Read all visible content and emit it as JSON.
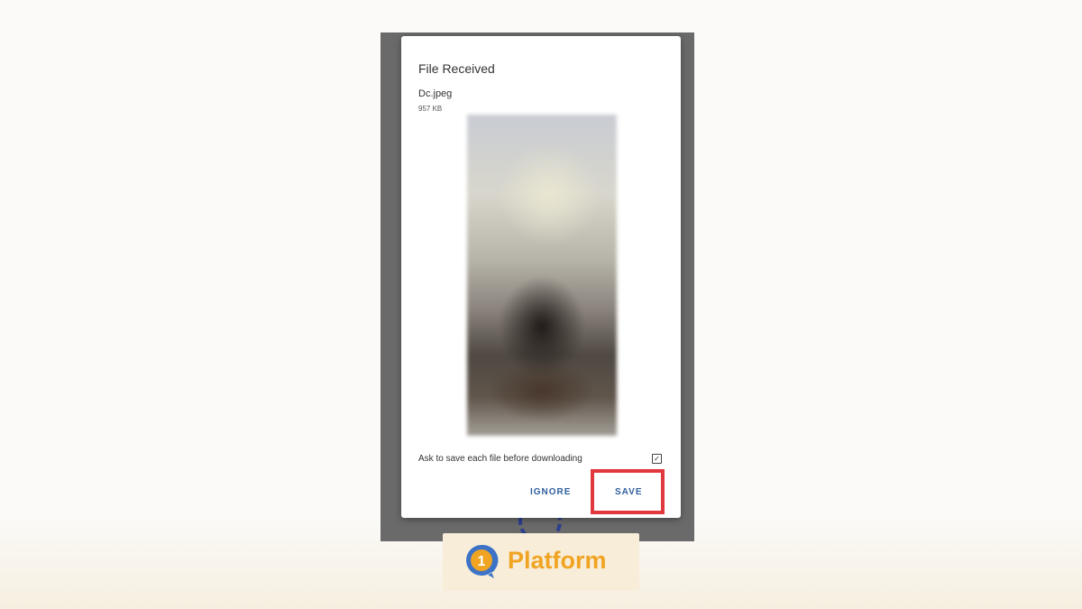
{
  "dialog": {
    "title": "File Received",
    "filename": "Dc.jpeg",
    "filesize": "957 KB",
    "ask_label": "Ask to save each file before downloading",
    "ask_checked": true,
    "ignore_label": "IGNORE",
    "save_label": "SAVE"
  },
  "brand": {
    "logo_digit": "1",
    "name": "Platform"
  },
  "colors": {
    "accent_button": "#2f5f9e",
    "highlight": "#e0383f",
    "brand_text": "#f0a422",
    "logo_blue": "#3d73c7"
  }
}
